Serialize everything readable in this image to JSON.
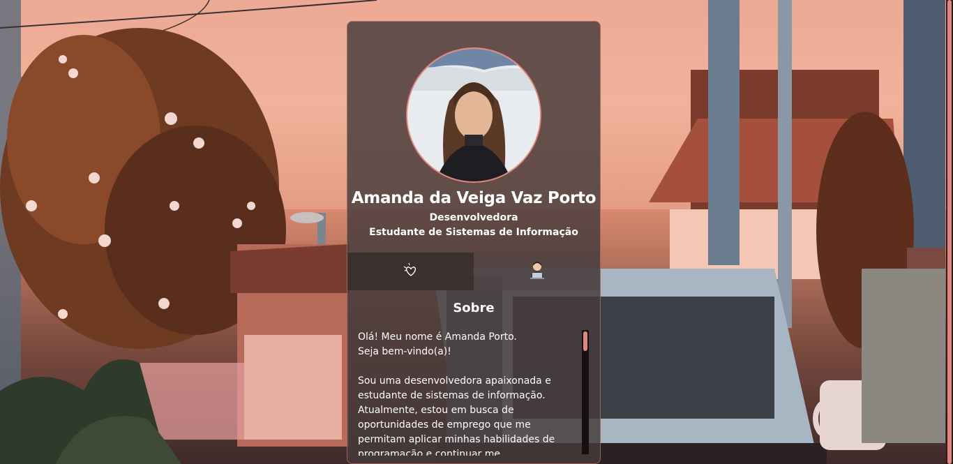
{
  "profile": {
    "name": "Amanda da Veiga Vaz Porto",
    "role": "Desenvolvedora",
    "study": "Estudante de Sistemas de Informação"
  },
  "tabs": [
    {
      "id": "sobre",
      "icon": "sparkle-heart-icon",
      "active": true
    },
    {
      "id": "dev",
      "icon": "developer-laptop-icon",
      "active": false
    }
  ],
  "about": {
    "title": "Sobre",
    "text": "Olá! Meu nome é Amanda Porto.\nSeja bem-vindo(a)!\n\nSou uma desenvolvedora apaixonada e estudante de sistemas de informação. Atualmente, estou em busca de oportunidades de emprego que me permitam aplicar minhas habilidades de programação e continuar me"
  },
  "colors": {
    "accent": "#e0877e",
    "card": "#463a3a"
  }
}
